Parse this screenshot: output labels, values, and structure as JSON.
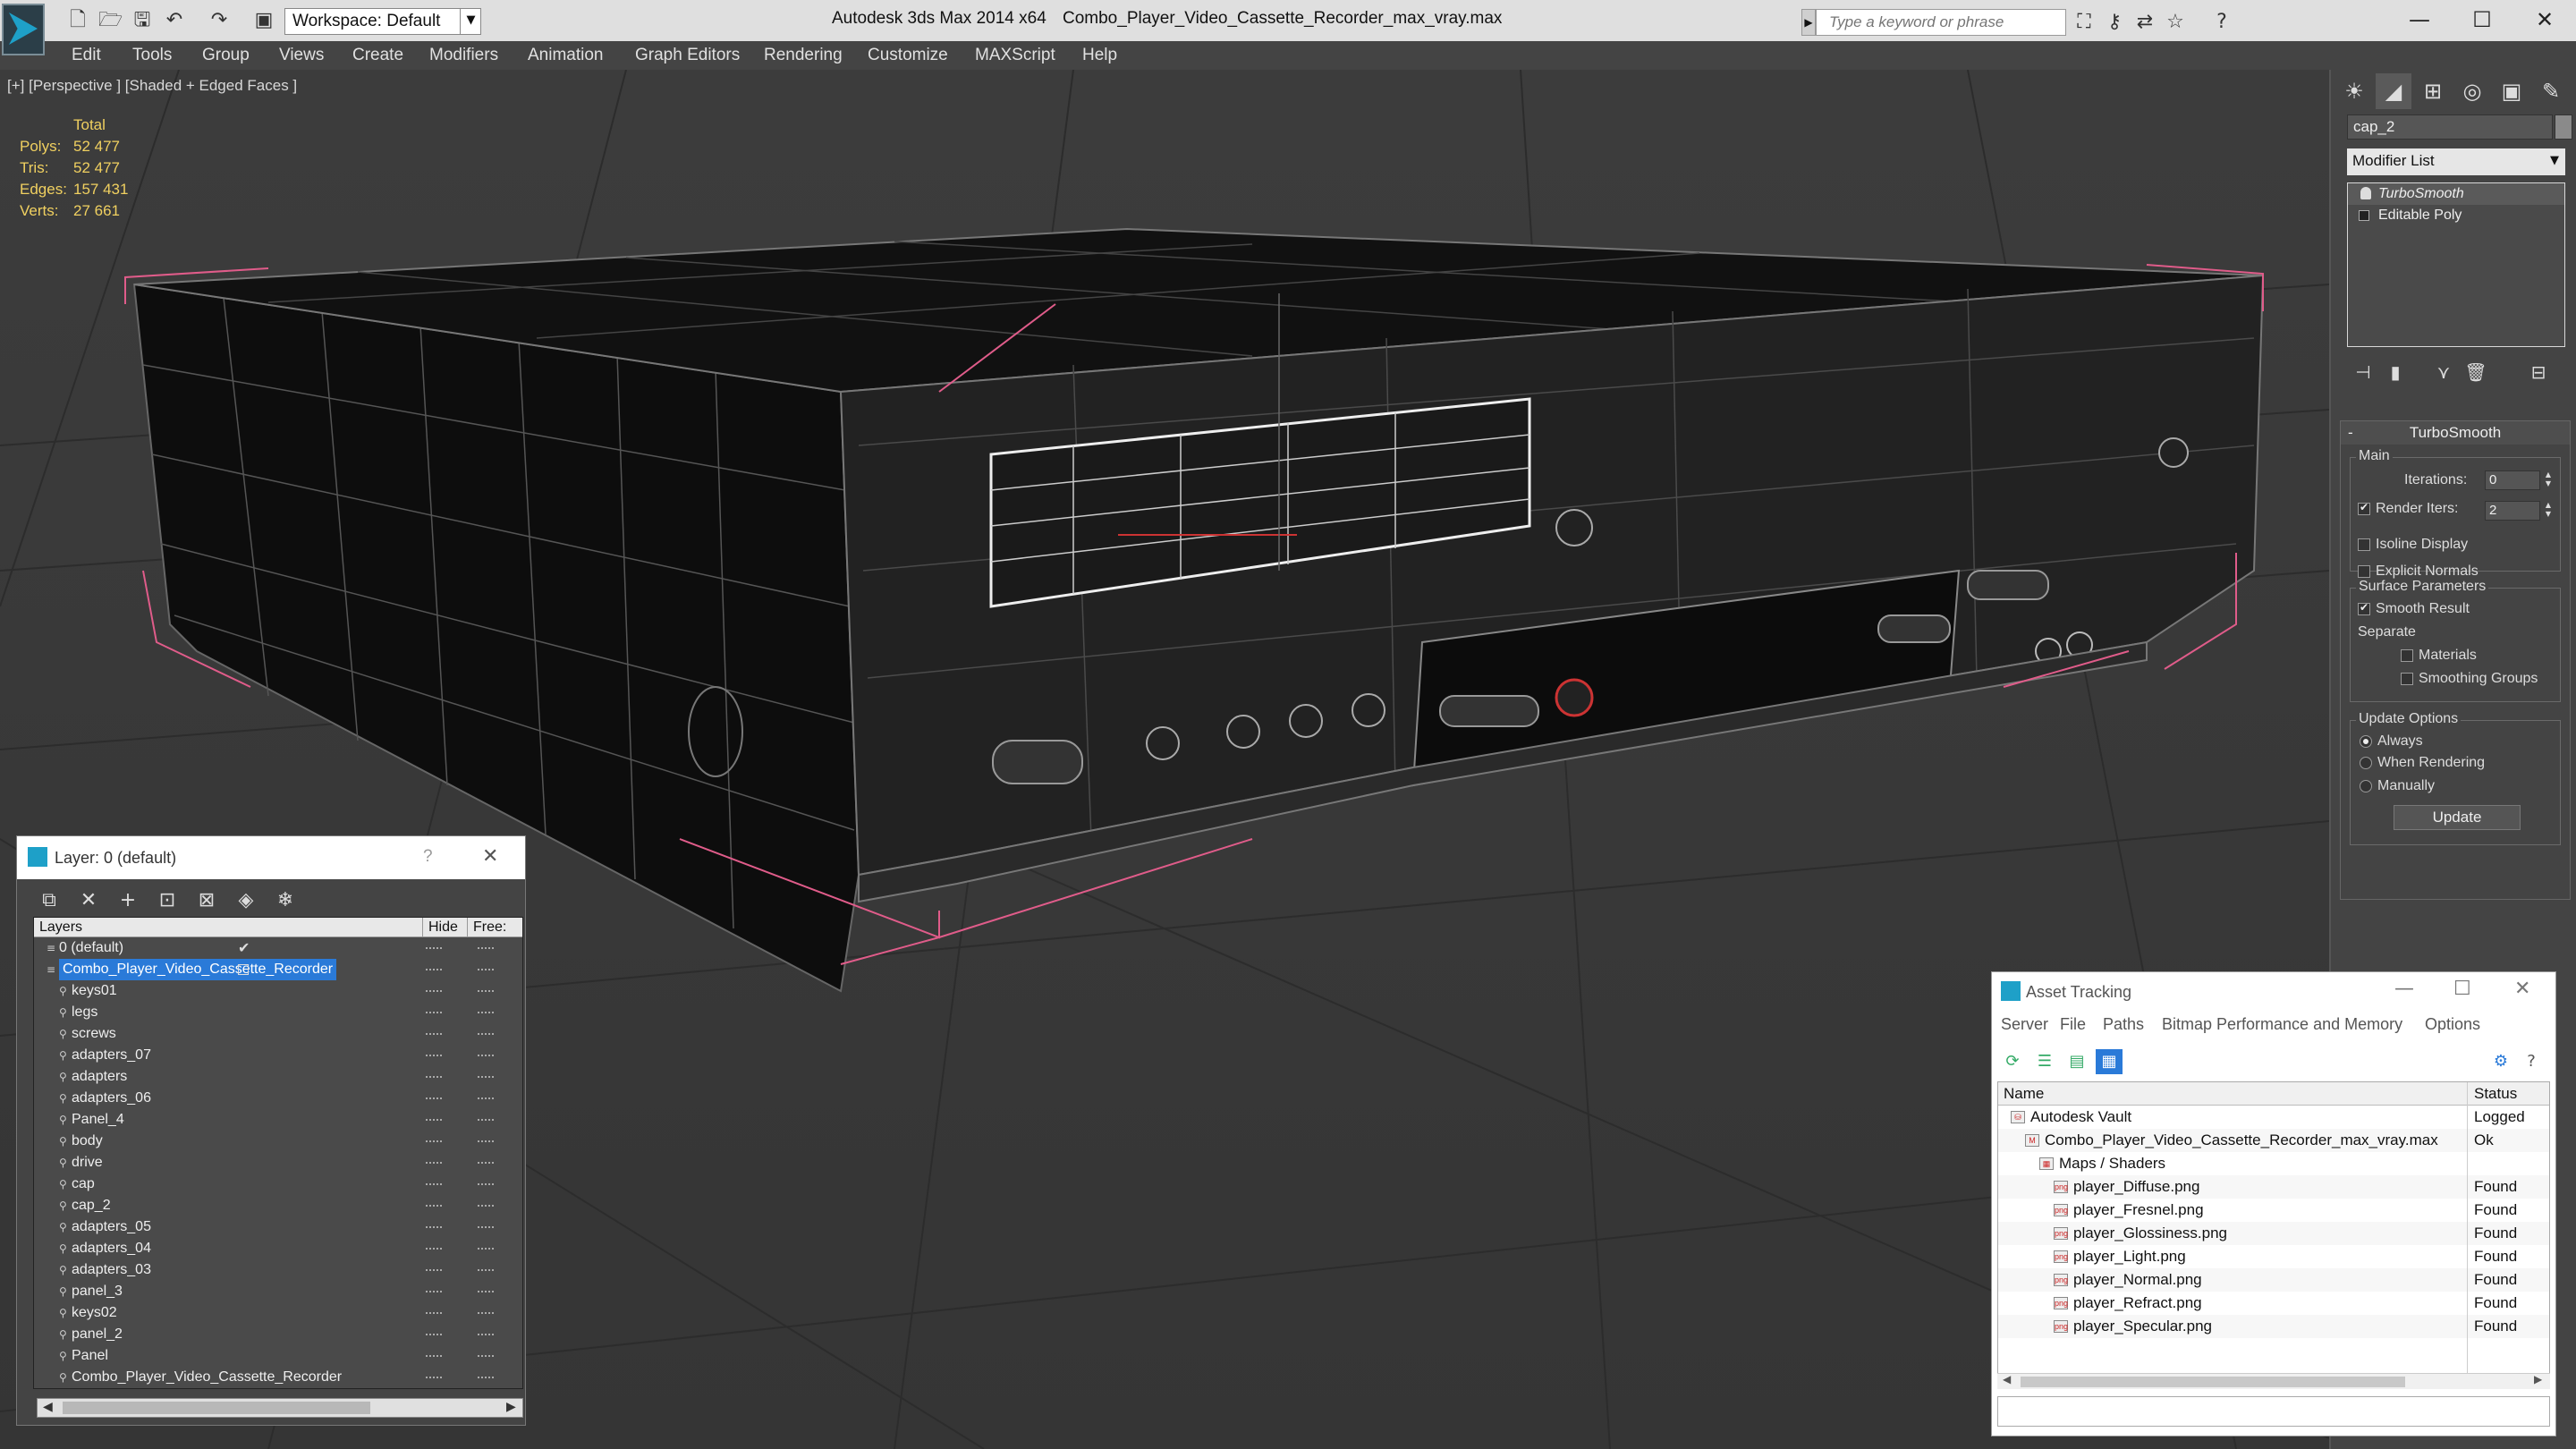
{
  "titlebar": {
    "app_title": "Autodesk 3ds Max  2014 x64",
    "file_title": "Combo_Player_Video_Cassette_Recorder_max_vray.max",
    "workspace": "Workspace: Default",
    "search_placeholder": "Type a keyword or phrase"
  },
  "menu": [
    "Edit",
    "Tools",
    "Group",
    "Views",
    "Create",
    "Modifiers",
    "Animation",
    "Graph Editors",
    "Rendering",
    "Customize",
    "MAXScript",
    "Help"
  ],
  "viewport": {
    "label": "[+] [Perspective ] [Shaded + Edged Faces ]",
    "stats": {
      "header": "Total",
      "polys_label": "Polys:",
      "polys": "52 477",
      "tris_label": "Tris:",
      "tris": "52 477",
      "edges_label": "Edges:",
      "edges": "157 431",
      "verts_label": "Verts:",
      "verts": "27 661"
    }
  },
  "command_panel": {
    "object_name": "cap_2",
    "object_color": "#8a8a8a",
    "modifier_list": "Modifier List",
    "stack": [
      "TurboSmooth",
      "Editable Poly"
    ],
    "rollout_title": "TurboSmooth",
    "main_group": "Main",
    "iterations_label": "Iterations:",
    "iterations": "0",
    "render_iters_label": "Render Iters:",
    "render_iters": "2",
    "isoline_label": "Isoline Display",
    "explicit_normals_label": "Explicit Normals",
    "surface_group": "Surface Parameters",
    "smooth_result_label": "Smooth Result",
    "separate_label": "Separate",
    "materials_label": "Materials",
    "smoothing_groups_label": "Smoothing Groups",
    "update_group": "Update Options",
    "always_label": "Always",
    "when_rendering_label": "When Rendering",
    "manually_label": "Manually",
    "update_button": "Update"
  },
  "layer_dialog": {
    "title": "Layer: 0 (default)",
    "help": "?",
    "col_layers": "Layers",
    "col_hide": "Hide",
    "col_freeze": "Free:",
    "rows": [
      {
        "name": "0 (default)",
        "level": 0
      },
      {
        "name": "Combo_Player_Video_Cassette_Recorder",
        "level": 0
      },
      {
        "name": "keys01",
        "level": 1
      },
      {
        "name": "legs",
        "level": 1
      },
      {
        "name": "screws",
        "level": 1
      },
      {
        "name": "adapters_07",
        "level": 1
      },
      {
        "name": "adapters",
        "level": 1
      },
      {
        "name": "adapters_06",
        "level": 1
      },
      {
        "name": "Panel_4",
        "level": 1
      },
      {
        "name": "body",
        "level": 1
      },
      {
        "name": "drive",
        "level": 1
      },
      {
        "name": "cap",
        "level": 1
      },
      {
        "name": "cap_2",
        "level": 1
      },
      {
        "name": "adapters_05",
        "level": 1
      },
      {
        "name": "adapters_04",
        "level": 1
      },
      {
        "name": "adapters_03",
        "level": 1
      },
      {
        "name": "panel_3",
        "level": 1
      },
      {
        "name": "keys02",
        "level": 1
      },
      {
        "name": "panel_2",
        "level": 1
      },
      {
        "name": "Panel",
        "level": 1
      },
      {
        "name": "Combo_Player_Video_Cassette_Recorder",
        "level": 1
      }
    ]
  },
  "asset_dialog": {
    "title": "Asset Tracking",
    "menu": [
      "Server",
      "File",
      "Paths",
      "Bitmap Performance and Memory",
      "Options"
    ],
    "col_name": "Name",
    "col_status": "Status",
    "rows": [
      {
        "name": "Autodesk Vault",
        "status": "Logged Ou",
        "level": 0
      },
      {
        "name": "Combo_Player_Video_Cassette_Recorder_max_vray.max",
        "status": "Ok",
        "level": 1
      },
      {
        "name": "Maps / Shaders",
        "status": "",
        "level": 2
      },
      {
        "name": "player_Diffuse.png",
        "status": "Found",
        "level": 3
      },
      {
        "name": "player_Fresnel.png",
        "status": "Found",
        "level": 3
      },
      {
        "name": "player_Glossiness.png",
        "status": "Found",
        "level": 3
      },
      {
        "name": "player_Light.png",
        "status": "Found",
        "level": 3
      },
      {
        "name": "player_Normal.png",
        "status": "Found",
        "level": 3
      },
      {
        "name": "player_Refract.png",
        "status": "Found",
        "level": 3
      },
      {
        "name": "player_Specular.png",
        "status": "Found",
        "level": 3
      }
    ]
  },
  "colors": {
    "accent": "#2a7ad8",
    "stats_text": "#f0d060",
    "bbox_corner": "#e05c8a"
  }
}
